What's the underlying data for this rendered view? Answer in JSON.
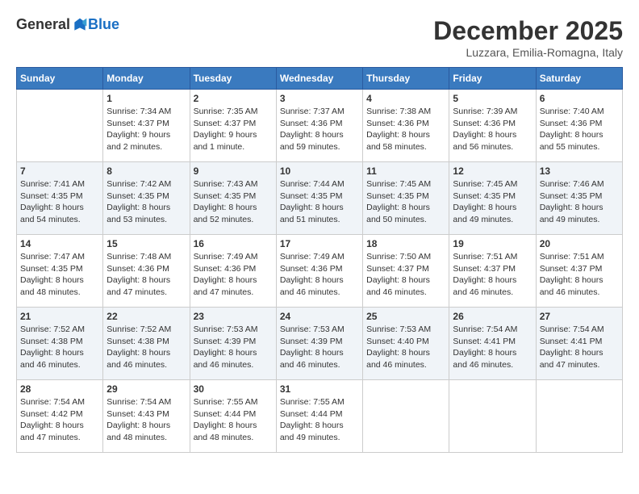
{
  "header": {
    "logo_general": "General",
    "logo_blue": "Blue",
    "month_title": "December 2025",
    "location": "Luzzara, Emilia-Romagna, Italy"
  },
  "days_of_week": [
    "Sunday",
    "Monday",
    "Tuesday",
    "Wednesday",
    "Thursday",
    "Friday",
    "Saturday"
  ],
  "weeks": [
    [
      {
        "day": "",
        "info": ""
      },
      {
        "day": "1",
        "info": "Sunrise: 7:34 AM\nSunset: 4:37 PM\nDaylight: 9 hours\nand 2 minutes."
      },
      {
        "day": "2",
        "info": "Sunrise: 7:35 AM\nSunset: 4:37 PM\nDaylight: 9 hours\nand 1 minute."
      },
      {
        "day": "3",
        "info": "Sunrise: 7:37 AM\nSunset: 4:36 PM\nDaylight: 8 hours\nand 59 minutes."
      },
      {
        "day": "4",
        "info": "Sunrise: 7:38 AM\nSunset: 4:36 PM\nDaylight: 8 hours\nand 58 minutes."
      },
      {
        "day": "5",
        "info": "Sunrise: 7:39 AM\nSunset: 4:36 PM\nDaylight: 8 hours\nand 56 minutes."
      },
      {
        "day": "6",
        "info": "Sunrise: 7:40 AM\nSunset: 4:36 PM\nDaylight: 8 hours\nand 55 minutes."
      }
    ],
    [
      {
        "day": "7",
        "info": "Sunrise: 7:41 AM\nSunset: 4:35 PM\nDaylight: 8 hours\nand 54 minutes."
      },
      {
        "day": "8",
        "info": "Sunrise: 7:42 AM\nSunset: 4:35 PM\nDaylight: 8 hours\nand 53 minutes."
      },
      {
        "day": "9",
        "info": "Sunrise: 7:43 AM\nSunset: 4:35 PM\nDaylight: 8 hours\nand 52 minutes."
      },
      {
        "day": "10",
        "info": "Sunrise: 7:44 AM\nSunset: 4:35 PM\nDaylight: 8 hours\nand 51 minutes."
      },
      {
        "day": "11",
        "info": "Sunrise: 7:45 AM\nSunset: 4:35 PM\nDaylight: 8 hours\nand 50 minutes."
      },
      {
        "day": "12",
        "info": "Sunrise: 7:45 AM\nSunset: 4:35 PM\nDaylight: 8 hours\nand 49 minutes."
      },
      {
        "day": "13",
        "info": "Sunrise: 7:46 AM\nSunset: 4:35 PM\nDaylight: 8 hours\nand 49 minutes."
      }
    ],
    [
      {
        "day": "14",
        "info": "Sunrise: 7:47 AM\nSunset: 4:35 PM\nDaylight: 8 hours\nand 48 minutes."
      },
      {
        "day": "15",
        "info": "Sunrise: 7:48 AM\nSunset: 4:36 PM\nDaylight: 8 hours\nand 47 minutes."
      },
      {
        "day": "16",
        "info": "Sunrise: 7:49 AM\nSunset: 4:36 PM\nDaylight: 8 hours\nand 47 minutes."
      },
      {
        "day": "17",
        "info": "Sunrise: 7:49 AM\nSunset: 4:36 PM\nDaylight: 8 hours\nand 46 minutes."
      },
      {
        "day": "18",
        "info": "Sunrise: 7:50 AM\nSunset: 4:37 PM\nDaylight: 8 hours\nand 46 minutes."
      },
      {
        "day": "19",
        "info": "Sunrise: 7:51 AM\nSunset: 4:37 PM\nDaylight: 8 hours\nand 46 minutes."
      },
      {
        "day": "20",
        "info": "Sunrise: 7:51 AM\nSunset: 4:37 PM\nDaylight: 8 hours\nand 46 minutes."
      }
    ],
    [
      {
        "day": "21",
        "info": "Sunrise: 7:52 AM\nSunset: 4:38 PM\nDaylight: 8 hours\nand 46 minutes."
      },
      {
        "day": "22",
        "info": "Sunrise: 7:52 AM\nSunset: 4:38 PM\nDaylight: 8 hours\nand 46 minutes."
      },
      {
        "day": "23",
        "info": "Sunrise: 7:53 AM\nSunset: 4:39 PM\nDaylight: 8 hours\nand 46 minutes."
      },
      {
        "day": "24",
        "info": "Sunrise: 7:53 AM\nSunset: 4:39 PM\nDaylight: 8 hours\nand 46 minutes."
      },
      {
        "day": "25",
        "info": "Sunrise: 7:53 AM\nSunset: 4:40 PM\nDaylight: 8 hours\nand 46 minutes."
      },
      {
        "day": "26",
        "info": "Sunrise: 7:54 AM\nSunset: 4:41 PM\nDaylight: 8 hours\nand 46 minutes."
      },
      {
        "day": "27",
        "info": "Sunrise: 7:54 AM\nSunset: 4:41 PM\nDaylight: 8 hours\nand 47 minutes."
      }
    ],
    [
      {
        "day": "28",
        "info": "Sunrise: 7:54 AM\nSunset: 4:42 PM\nDaylight: 8 hours\nand 47 minutes."
      },
      {
        "day": "29",
        "info": "Sunrise: 7:54 AM\nSunset: 4:43 PM\nDaylight: 8 hours\nand 48 minutes."
      },
      {
        "day": "30",
        "info": "Sunrise: 7:55 AM\nSunset: 4:44 PM\nDaylight: 8 hours\nand 48 minutes."
      },
      {
        "day": "31",
        "info": "Sunrise: 7:55 AM\nSunset: 4:44 PM\nDaylight: 8 hours\nand 49 minutes."
      },
      {
        "day": "",
        "info": ""
      },
      {
        "day": "",
        "info": ""
      },
      {
        "day": "",
        "info": ""
      }
    ]
  ]
}
